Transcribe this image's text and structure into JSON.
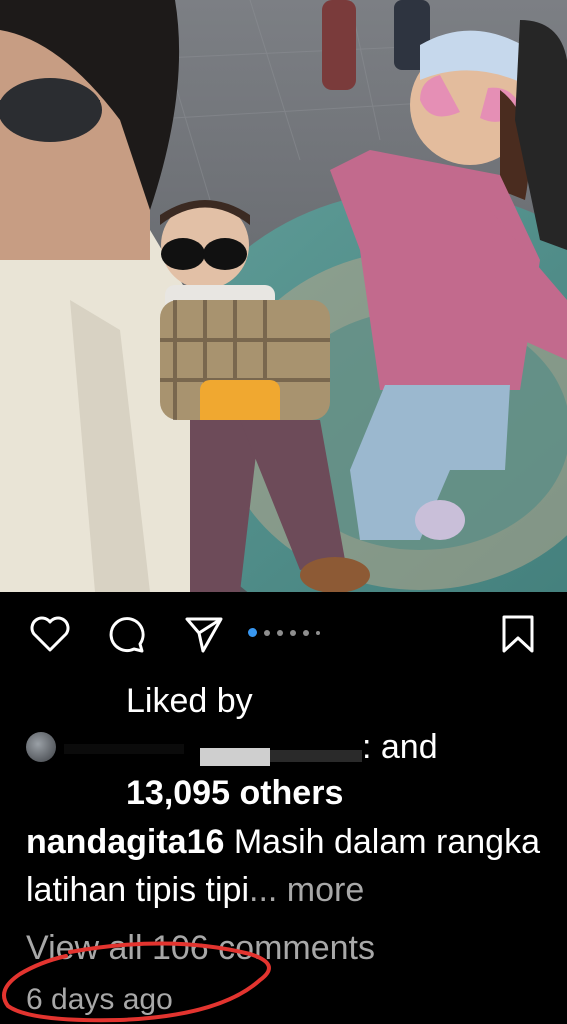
{
  "post": {
    "photo": {
      "description_icon": "image-icon"
    },
    "carousel": {
      "count": 6,
      "active_index": 0
    },
    "actions": {
      "like_icon": "heart-icon",
      "comment_icon": "comment-icon",
      "share_icon": "send-icon",
      "save_icon": "bookmark-icon"
    },
    "likes": {
      "liked_by": "Liked by",
      "liker_tail": ": and",
      "others": "13,095 others"
    },
    "caption": {
      "username": "nandagita16",
      "text": "Masih dalam rangka latihan tipis tipi",
      "more": "... more"
    },
    "comments": {
      "view_all": "View all 106 comments"
    },
    "timestamp": "6 days ago",
    "colors": {
      "background": "#000000",
      "text": "#ffffff",
      "muted": "#a8a8a8",
      "active_dot": "#3897f0",
      "annotation": "#e3342f"
    }
  }
}
